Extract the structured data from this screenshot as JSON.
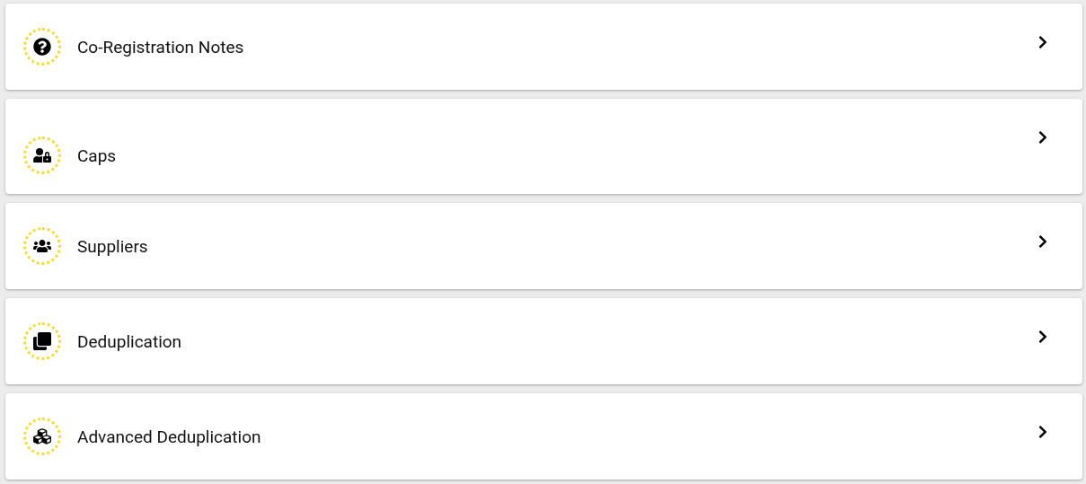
{
  "items": [
    {
      "label": "Co-Registration Notes"
    },
    {
      "label": "Caps"
    },
    {
      "label": "Suppliers"
    },
    {
      "label": "Deduplication"
    },
    {
      "label": "Advanced Deduplication"
    }
  ]
}
